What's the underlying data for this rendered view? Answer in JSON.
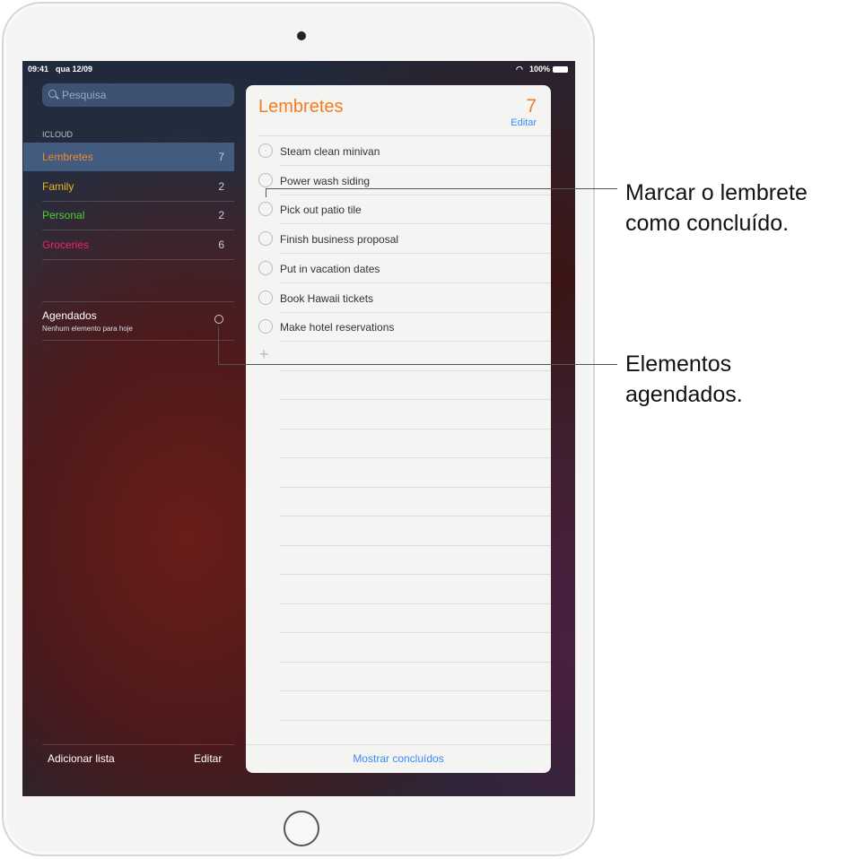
{
  "status": {
    "time": "09:41",
    "date": "qua 12/09",
    "battery": "100%"
  },
  "sidebar": {
    "search_placeholder": "Pesquisa",
    "section": "ICLOUD",
    "lists": [
      {
        "label": "Lembretes",
        "count": "7",
        "color": "#f08a2a"
      },
      {
        "label": "Family",
        "count": "2",
        "color": "#e8b81a"
      },
      {
        "label": "Personal",
        "count": "2",
        "color": "#4cd137"
      },
      {
        "label": "Groceries",
        "count": "6",
        "color": "#f0246c"
      }
    ],
    "scheduled": {
      "title": "Agendados",
      "subtitle": "Nenhum elemento para hoje"
    },
    "add_list": "Adicionar lista",
    "edit": "Editar"
  },
  "main": {
    "title": "Lembretes",
    "count": "7",
    "edit": "Editar",
    "items": [
      "Steam clean minivan",
      "Power wash siding",
      "Pick out patio tile",
      "Finish business proposal",
      "Put in vacation dates",
      "Book Hawaii tickets",
      "Make hotel reservations"
    ],
    "show_completed": "Mostrar concluídos"
  },
  "callouts": {
    "complete": [
      "Marcar o lembrete",
      "como concluído."
    ],
    "scheduled": [
      "Elementos",
      "agendados."
    ]
  }
}
